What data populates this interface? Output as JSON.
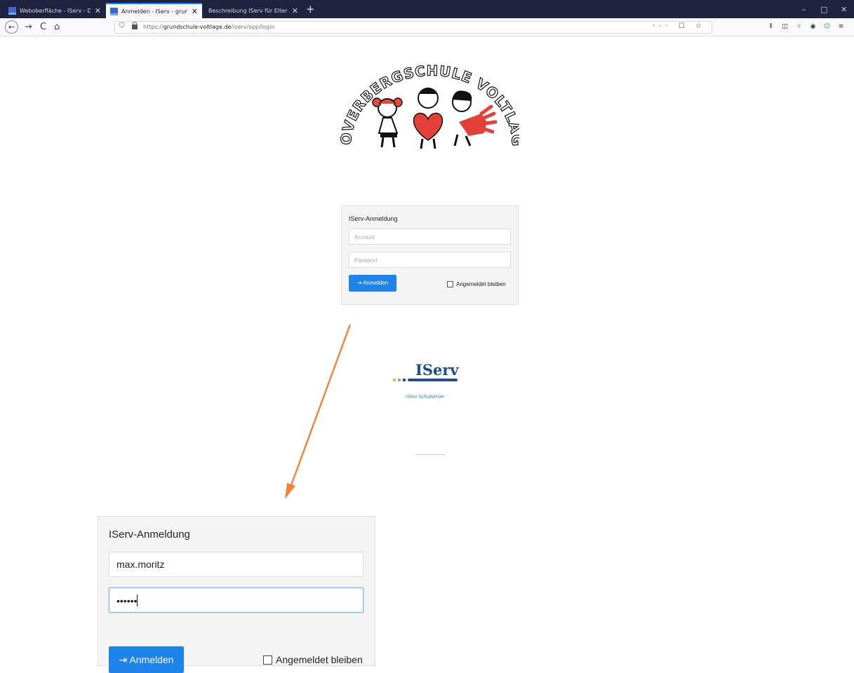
{
  "browser": {
    "tabs": [
      {
        "title": "Weboberfläche - IServ - Dokum",
        "active": false
      },
      {
        "title": "Anmelden - IServ - grundschul",
        "active": true
      },
      {
        "title": "Beschreibung IServ für Eltern.pdf",
        "active": false
      }
    ],
    "new_tab_glyph": "+",
    "close_glyph": "✕",
    "window_controls": {
      "minimize": "–",
      "maximize": "□",
      "close": "✕"
    },
    "url": {
      "prefix": "https://",
      "domain": "grundschule-voltlage.de",
      "path": "/iserv/app/login"
    },
    "url_actions": "··· ☐ ☆",
    "nav": {
      "back": "←",
      "forward": "→",
      "reload": "C",
      "home": "⌂"
    }
  },
  "logo": {
    "text": "OVERBERGSCHULE VOLTLAGE"
  },
  "login_small": {
    "title": "IServ-Anmeldung",
    "account_placeholder": "Account",
    "password_placeholder": "Passwort",
    "submit_label": "Anmelden",
    "remember_label": "Angemeldet bleiben"
  },
  "iserv": {
    "brand": "IServ",
    "subtitle": "IServ Schulserver"
  },
  "login_large": {
    "title": "IServ-Anmeldung",
    "account_value": "max.moritz",
    "password_mask": "••••••",
    "submit_label": "Anmelden",
    "remember_label": "Angemeldet bleiben"
  },
  "colors": {
    "accent": "#1f84ea",
    "arrow": "#ee8436",
    "tabbar": "#202340",
    "iserv_blue": "#1d4f8c"
  }
}
